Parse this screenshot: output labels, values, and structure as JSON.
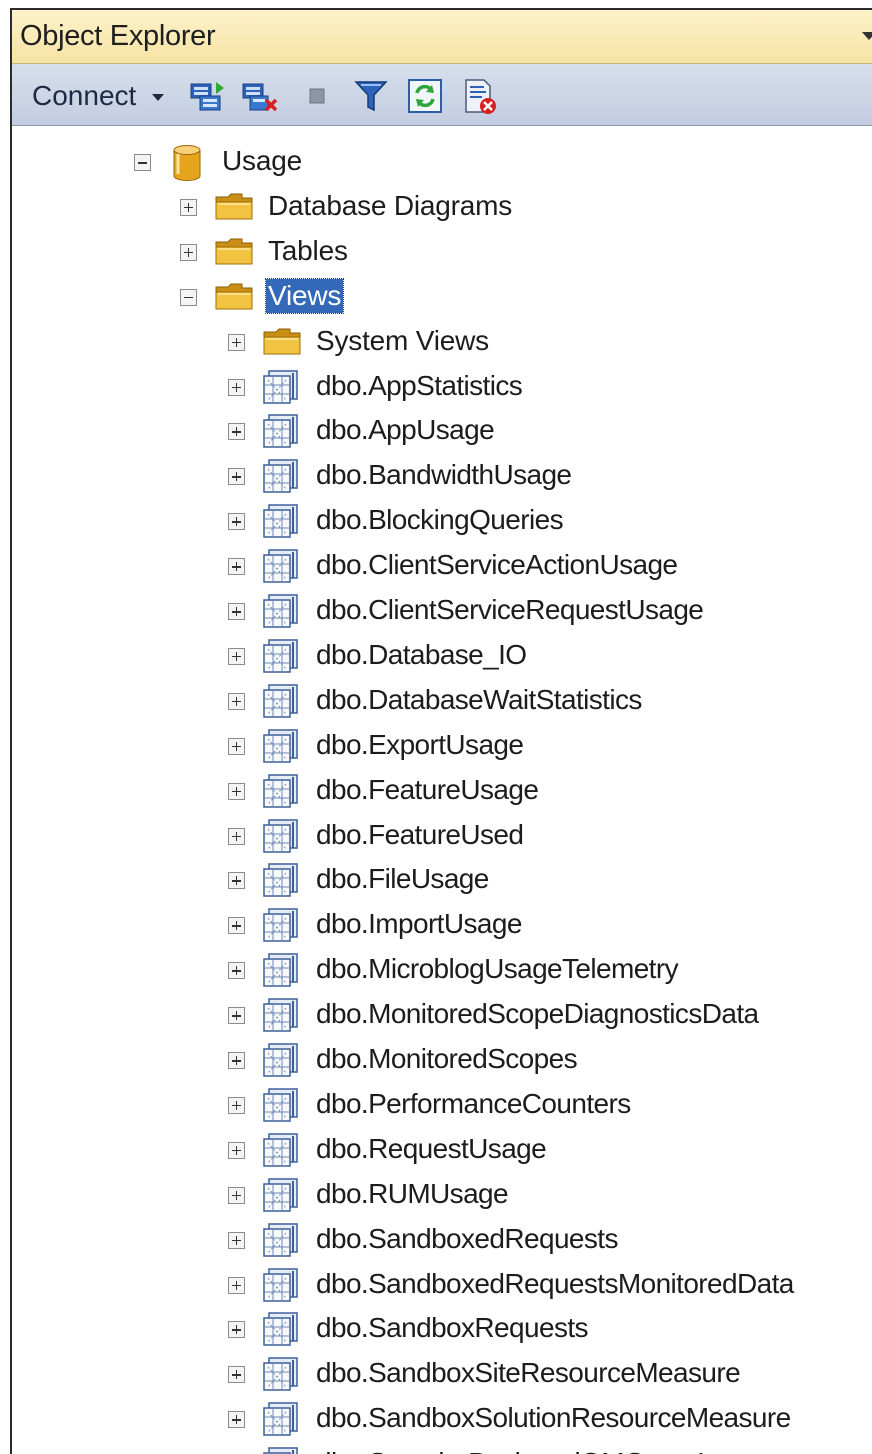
{
  "panel": {
    "title": "Object Explorer"
  },
  "toolbar": {
    "connect_label": "Connect",
    "icons": [
      "connect-object-explorer-icon",
      "disconnect-icon",
      "stop-icon",
      "filter-icon",
      "refresh-icon",
      "summary-report-icon"
    ]
  },
  "colors": {
    "title_bg": "#f6e3a4",
    "toolbar_bg": "#c9d2e3",
    "selection": "#3468b8",
    "folder": "#e8b537"
  },
  "tree": {
    "database": {
      "label": "Usage",
      "icon": "database-icon",
      "expanded": true
    },
    "folders": [
      {
        "label": "Database Diagrams",
        "icon": "folder-icon",
        "expanded": false
      },
      {
        "label": "Tables",
        "icon": "folder-icon",
        "expanded": false
      },
      {
        "label": "Views",
        "icon": "folder-icon",
        "expanded": true,
        "selected": true
      }
    ],
    "views_children": [
      {
        "label": "System Views",
        "icon": "folder-icon"
      },
      {
        "label": "dbo.AppStatistics",
        "icon": "view-icon"
      },
      {
        "label": "dbo.AppUsage",
        "icon": "view-icon"
      },
      {
        "label": "dbo.BandwidthUsage",
        "icon": "view-icon"
      },
      {
        "label": "dbo.BlockingQueries",
        "icon": "view-icon"
      },
      {
        "label": "dbo.ClientServiceActionUsage",
        "icon": "view-icon"
      },
      {
        "label": "dbo.ClientServiceRequestUsage",
        "icon": "view-icon"
      },
      {
        "label": "dbo.Database_IO",
        "icon": "view-icon"
      },
      {
        "label": "dbo.DatabaseWaitStatistics",
        "icon": "view-icon"
      },
      {
        "label": "dbo.ExportUsage",
        "icon": "view-icon"
      },
      {
        "label": "dbo.FeatureUsage",
        "icon": "view-icon"
      },
      {
        "label": "dbo.FeatureUsed",
        "icon": "view-icon"
      },
      {
        "label": "dbo.FileUsage",
        "icon": "view-icon"
      },
      {
        "label": "dbo.ImportUsage",
        "icon": "view-icon"
      },
      {
        "label": "dbo.MicroblogUsageTelemetry",
        "icon": "view-icon"
      },
      {
        "label": "dbo.MonitoredScopeDiagnosticsData",
        "icon": "view-icon"
      },
      {
        "label": "dbo.MonitoredScopes",
        "icon": "view-icon"
      },
      {
        "label": "dbo.PerformanceCounters",
        "icon": "view-icon"
      },
      {
        "label": "dbo.RequestUsage",
        "icon": "view-icon"
      },
      {
        "label": "dbo.RUMUsage",
        "icon": "view-icon"
      },
      {
        "label": "dbo.SandboxedRequests",
        "icon": "view-icon"
      },
      {
        "label": "dbo.SandboxedRequestsMonitoredData",
        "icon": "view-icon"
      },
      {
        "label": "dbo.SandboxRequests",
        "icon": "view-icon"
      },
      {
        "label": "dbo.SandboxSiteResourceMeasure",
        "icon": "view-icon"
      },
      {
        "label": "dbo.SandboxSolutionResourceMeasure",
        "icon": "view-icon"
      },
      {
        "label": "dbo.Search_BucketedQMQueryLatency",
        "icon": "view-icon"
      }
    ]
  }
}
